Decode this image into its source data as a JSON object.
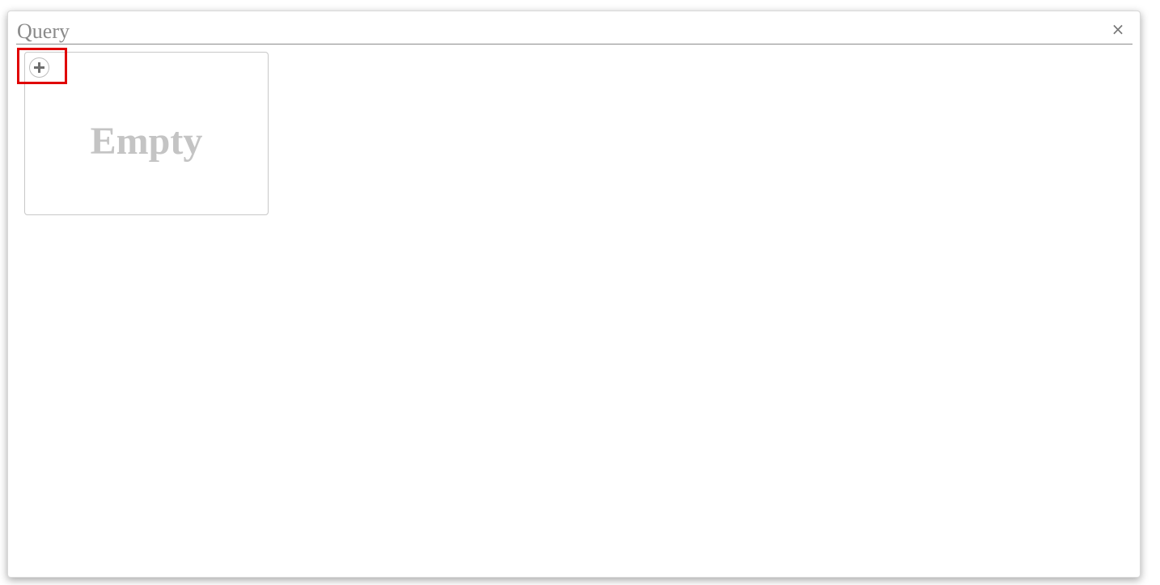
{
  "dialog": {
    "title": "Query",
    "close_label": "×"
  },
  "card": {
    "empty_label": "Empty",
    "add_icon": "plus-circle-icon"
  },
  "colors": {
    "highlight": "#e00000",
    "title_text": "#8a8a8a",
    "empty_text": "#c4c4c4"
  }
}
